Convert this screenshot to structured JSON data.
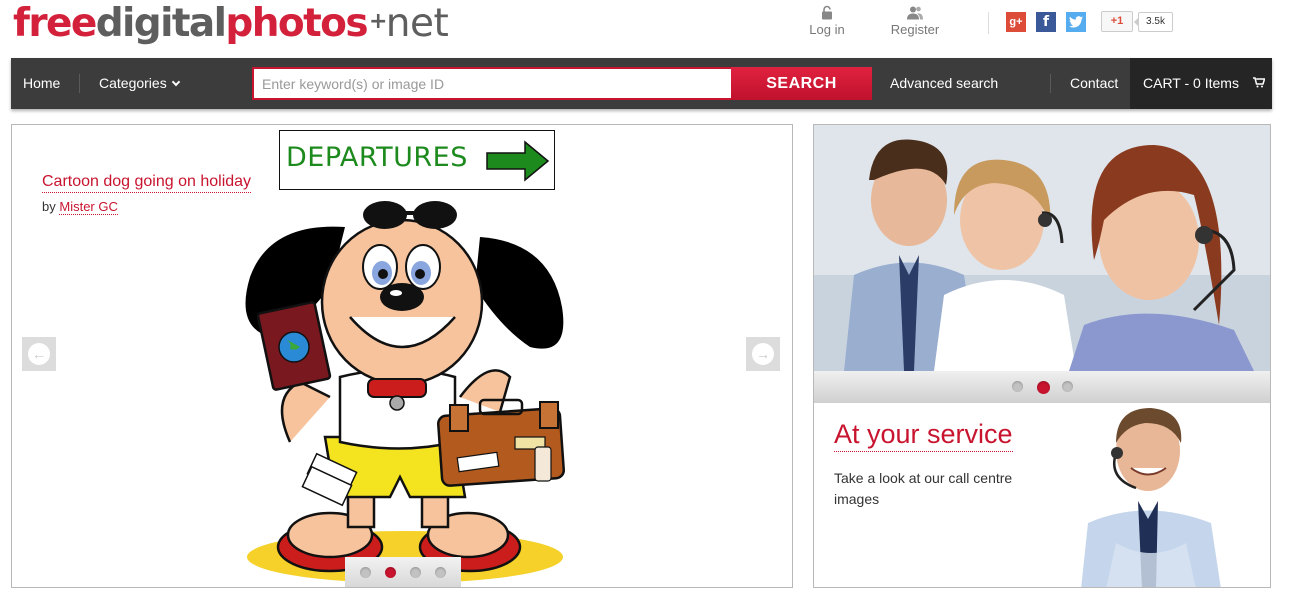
{
  "logo": {
    "free": "free",
    "digital": "digital",
    "photos": "photos",
    "plus": "+",
    "net": "net"
  },
  "header": {
    "login": "Log in",
    "register": "Register",
    "plus_one": "+1",
    "share_count": "3.5k"
  },
  "social": {
    "google": "g+",
    "facebook": "f",
    "twitter": "t"
  },
  "nav": {
    "home": "Home",
    "categories": "Categories",
    "search_placeholder": "Enter keyword(s) or image ID",
    "search_button": "SEARCH",
    "advanced": "Advanced search",
    "contact": "Contact",
    "cart": "CART - 0 Items"
  },
  "hero": {
    "title": "Cartoon dog going on holiday",
    "by": "by",
    "author": "Mister GC",
    "sign_text": "DEPARTURES",
    "dots_count": 4,
    "active_dot": 2
  },
  "side": {
    "title": "At your service",
    "text": "Take a look at our call centre images",
    "dots_count": 3,
    "active_dot": 2
  },
  "colors": {
    "accent": "#c8142f",
    "nav_bg": "#3c3c3c",
    "cart_bg": "#252525"
  }
}
